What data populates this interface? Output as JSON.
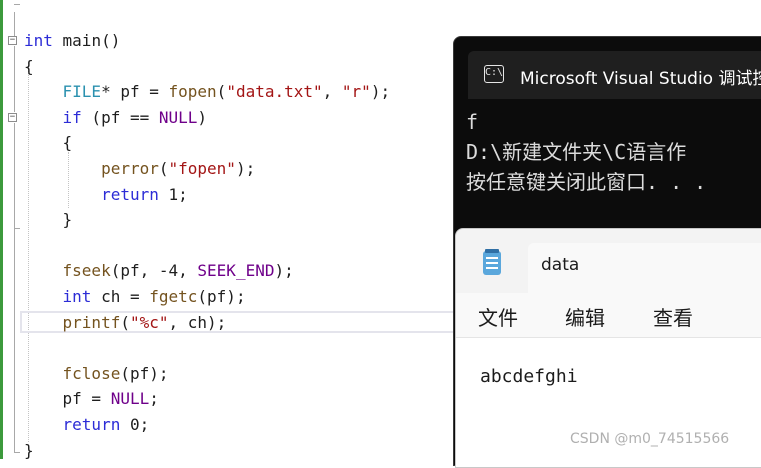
{
  "editor": {
    "lines": [
      {
        "parts": [
          {
            "t": "int",
            "c": "kw"
          },
          {
            "t": " main()",
            "c": ""
          }
        ]
      },
      {
        "parts": [
          {
            "t": "{",
            "c": ""
          }
        ]
      },
      {
        "parts": [
          {
            "t": "    ",
            "c": ""
          },
          {
            "t": "FILE",
            "c": "ty"
          },
          {
            "t": "* pf = ",
            "c": ""
          },
          {
            "t": "fopen",
            "c": "fn"
          },
          {
            "t": "(",
            "c": ""
          },
          {
            "t": "\"data.txt\"",
            "c": "st"
          },
          {
            "t": ", ",
            "c": ""
          },
          {
            "t": "\"r\"",
            "c": "st"
          },
          {
            "t": ");",
            "c": ""
          }
        ]
      },
      {
        "parts": [
          {
            "t": "    ",
            "c": ""
          },
          {
            "t": "if",
            "c": "kw"
          },
          {
            "t": " (pf == ",
            "c": ""
          },
          {
            "t": "NULL",
            "c": "mc"
          },
          {
            "t": ")",
            "c": ""
          }
        ]
      },
      {
        "parts": [
          {
            "t": "    {",
            "c": ""
          }
        ]
      },
      {
        "parts": [
          {
            "t": "        ",
            "c": ""
          },
          {
            "t": "perror",
            "c": "fn"
          },
          {
            "t": "(",
            "c": ""
          },
          {
            "t": "\"fopen\"",
            "c": "st"
          },
          {
            "t": ");",
            "c": ""
          }
        ]
      },
      {
        "parts": [
          {
            "t": "        ",
            "c": ""
          },
          {
            "t": "return",
            "c": "kw"
          },
          {
            "t": " 1;",
            "c": ""
          }
        ]
      },
      {
        "parts": [
          {
            "t": "    }",
            "c": ""
          }
        ]
      },
      {
        "parts": []
      },
      {
        "parts": [
          {
            "t": "    ",
            "c": ""
          },
          {
            "t": "fseek",
            "c": "fn"
          },
          {
            "t": "(pf, -4, ",
            "c": ""
          },
          {
            "t": "SEEK_END",
            "c": "mc"
          },
          {
            "t": ");",
            "c": ""
          }
        ]
      },
      {
        "parts": [
          {
            "t": "    ",
            "c": ""
          },
          {
            "t": "int",
            "c": "kw"
          },
          {
            "t": " ch = ",
            "c": ""
          },
          {
            "t": "fgetc",
            "c": "fn"
          },
          {
            "t": "(pf);",
            "c": ""
          }
        ]
      },
      {
        "parts": [
          {
            "t": "    ",
            "c": ""
          },
          {
            "t": "printf",
            "c": "fn"
          },
          {
            "t": "(",
            "c": ""
          },
          {
            "t": "\"%c\"",
            "c": "st"
          },
          {
            "t": ", ch);",
            "c": ""
          }
        ]
      },
      {
        "parts": []
      },
      {
        "parts": [
          {
            "t": "    ",
            "c": ""
          },
          {
            "t": "fclose",
            "c": "fn"
          },
          {
            "t": "(pf);",
            "c": ""
          }
        ]
      },
      {
        "parts": [
          {
            "t": "    pf = ",
            "c": ""
          },
          {
            "t": "NULL",
            "c": "mc"
          },
          {
            "t": ";",
            "c": ""
          }
        ]
      },
      {
        "parts": [
          {
            "t": "    ",
            "c": ""
          },
          {
            "t": "return",
            "c": "kw"
          },
          {
            "t": " 0;",
            "c": ""
          }
        ]
      },
      {
        "parts": [
          {
            "t": "}",
            "c": ""
          }
        ]
      }
    ]
  },
  "console": {
    "title": "Microsoft Visual Studio 调试控制台",
    "icon": "terminal-icon",
    "output": [
      "f",
      "D:\\新建文件夹\\C语言作",
      "按任意键关闭此窗口. . ."
    ]
  },
  "notepad": {
    "title": "data",
    "icon": "notepad-icon",
    "menu": [
      "文件",
      "编辑",
      "查看"
    ],
    "content": "abcdefghi"
  },
  "watermark": "CSDN @m0_74515566",
  "colors": {
    "keyword": "#2c2cd6",
    "type": "#2b91af",
    "function": "#74531f",
    "string": "#a31515",
    "macro": "#6f008a",
    "console_bg": "#0c0c0c"
  }
}
